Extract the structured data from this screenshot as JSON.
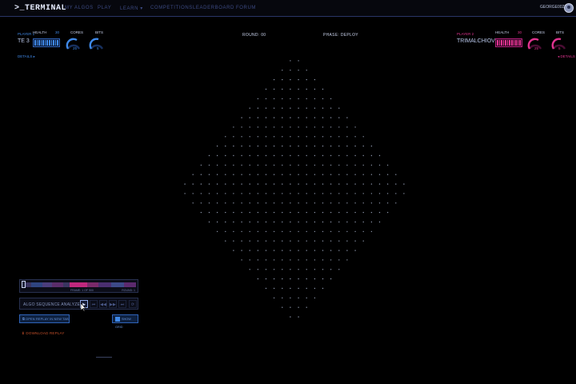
{
  "nav": {
    "logo": ">_TERMINAL",
    "items": [
      "MY ALGOS",
      "PLAY",
      "LEARN ▾",
      "COMPETITIONS",
      "LEADERBOARD",
      "FORUM"
    ],
    "user": "GEORGE0023"
  },
  "player1": {
    "tag": "PLAYER 1",
    "name": "TE 3",
    "health_label": "HEALTH",
    "health_value": "30",
    "cores_label": "CORES",
    "cores_value": "25",
    "bits_label": "BITS",
    "bits_value": "5",
    "details": "DETAILS ▸",
    "accent": "#3f89e8"
  },
  "player2": {
    "tag": "PLAYER 2",
    "name": "TRIMALCHIOVO 4",
    "health_label": "HEALTH",
    "health_value": "30",
    "cores_label": "CORES",
    "cores_value": "25",
    "bits_label": "BITS",
    "bits_value": "5",
    "details": "◂ DETAILS",
    "accent": "#e0338f"
  },
  "round_label": "ROUND: 00",
  "phase_label": "PHASE: DEPLOY",
  "board": {
    "size": 28,
    "dot_color": "#8a93a8"
  },
  "replay": {
    "frame_label": "FRAME: 1 OF 500",
    "round_label": "ROUND: 1",
    "analyzer_label": "ALGO SEQUENCE ANALYZER",
    "controls": [
      "▶",
      "⏮",
      "◀◀",
      "▶▶",
      "⏭",
      "⟳"
    ],
    "open_label": "OPEN REPLAY IN NEW TAB",
    "grid_label": "SHOW GRID",
    "download_label": "DOWNLOAD REPLAY"
  }
}
